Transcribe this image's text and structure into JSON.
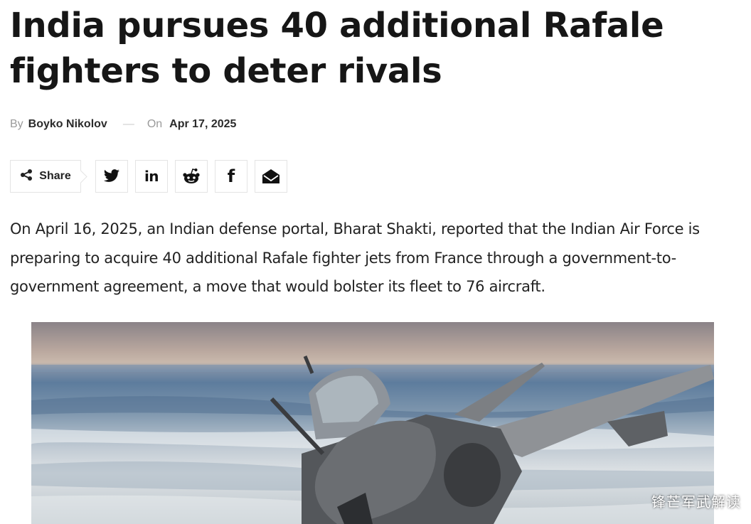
{
  "article": {
    "title": "India pursues 40 additional Rafale fighters to deter rivals",
    "byline": {
      "by_label": "By",
      "author": "Boyko Nikolov",
      "separator": "—",
      "on_label": "On",
      "date": "Apr 17, 2025"
    },
    "share": {
      "label": "Share",
      "buttons": [
        {
          "name": "twitter",
          "icon": "twitter-icon"
        },
        {
          "name": "linkedin",
          "icon": "linkedin-icon",
          "glyph": "in"
        },
        {
          "name": "reddit",
          "icon": "reddit-icon"
        },
        {
          "name": "facebook",
          "icon": "facebook-icon",
          "glyph": "f"
        },
        {
          "name": "email",
          "icon": "email-icon"
        }
      ]
    },
    "lead_paragraph": "On April 16, 2025, an Indian defense portal, Bharat Shakti, reported that the Indian Air Force is preparing to acquire 40 additional Rafale fighter jets from France through a government-to-government agreement, a move that would bolster its fleet to 76 aircraft.",
    "image": {
      "subject": "rafale-fighter-jet-photo"
    },
    "watermark": "锋芒军武解读"
  }
}
